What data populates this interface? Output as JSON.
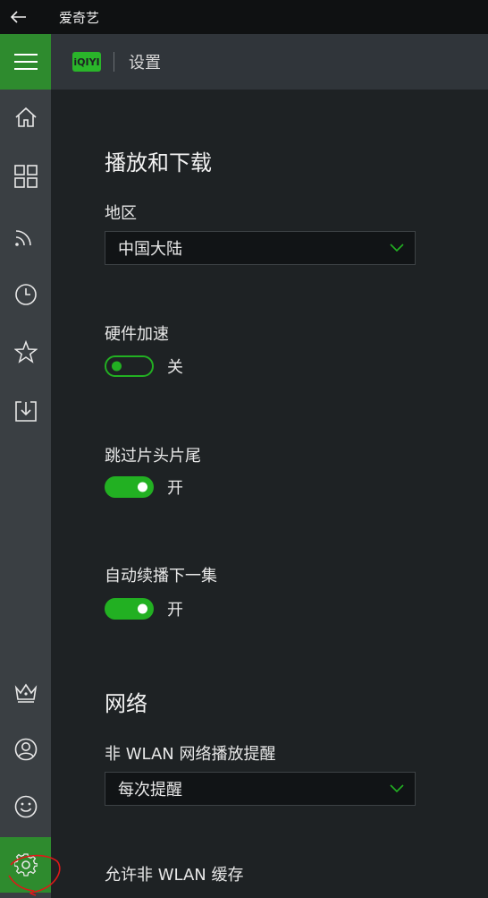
{
  "window": {
    "title": "爱奇艺"
  },
  "header": {
    "logo_text": "iQIYI",
    "title": "设置"
  },
  "sidebar": {
    "items": [
      {
        "icon": "hamburger-menu-icon"
      },
      {
        "icon": "home-icon"
      },
      {
        "icon": "grid-icon"
      },
      {
        "icon": "rss-feed-icon"
      },
      {
        "icon": "clock-history-icon"
      },
      {
        "icon": "star-favorites-icon"
      },
      {
        "icon": "download-icon"
      },
      {
        "icon": "vip-crown-icon"
      },
      {
        "icon": "user-profile-icon"
      },
      {
        "icon": "smiley-feedback-icon"
      },
      {
        "icon": "gear-settings-icon",
        "active": true
      }
    ]
  },
  "sections": {
    "playback": {
      "title": "播放和下载",
      "region_label": "地区",
      "region_value": "中国大陆",
      "hw_accel_label": "硬件加速",
      "hw_accel_state": "关",
      "skip_label": "跳过片头片尾",
      "skip_state": "开",
      "autoplay_label": "自动续播下一集",
      "autoplay_state": "开"
    },
    "network": {
      "title": "网络",
      "reminder_label": "非 WLAN 网络播放提醒",
      "reminder_value": "每次提醒",
      "cache_label": "允许非 WLAN 缓存"
    }
  },
  "colors": {
    "accent_green": "#22b022",
    "sidebar_active": "#2e8b2e",
    "background": "#1e2224"
  }
}
